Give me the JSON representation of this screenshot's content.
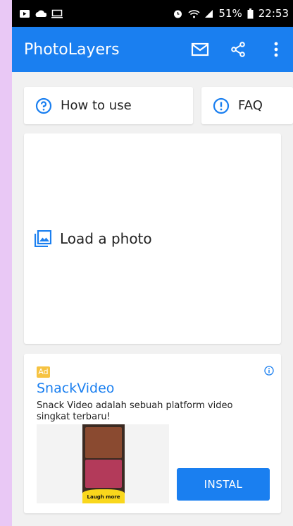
{
  "status_bar": {
    "battery_percent": "51%",
    "time": "22:53",
    "icons": [
      "gallery-icon",
      "cloud-icon",
      "screen-icon",
      "alarm-icon",
      "wifi-icon",
      "signal-icon",
      "battery-icon"
    ]
  },
  "app_bar": {
    "title": "PhotoLayers",
    "actions": [
      "mail-icon",
      "share-icon",
      "more-icon"
    ],
    "color": "#1a7ff0"
  },
  "buttons": {
    "how_to_use": "How to use",
    "faq": "FAQ"
  },
  "load": {
    "label": "Load a photo"
  },
  "ad": {
    "badge": "Ad",
    "title": "SnackVideo",
    "description": "Snack Video adalah sebuah platform video singkat terbaru!",
    "media_caption": "Laugh more",
    "install_label": "INSTAL"
  }
}
